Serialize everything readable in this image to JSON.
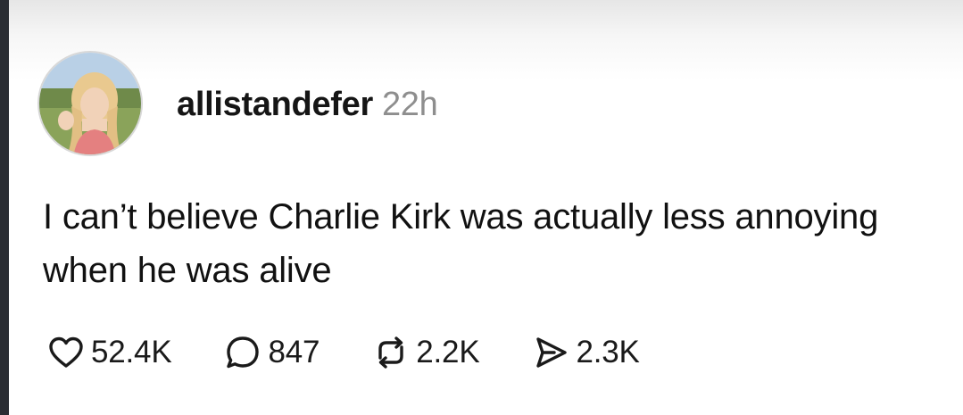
{
  "post": {
    "username": "allistandefer",
    "time_ago": "22h",
    "text": "I can’t believe Charlie Kirk was actually less annoying when he was alive"
  },
  "actions": {
    "likes": {
      "icon": "heart-icon",
      "count": "52.4K"
    },
    "replies": {
      "icon": "comment-icon",
      "count": "847"
    },
    "reposts": {
      "icon": "repost-icon",
      "count": "2.2K"
    },
    "shares": {
      "icon": "send-icon",
      "count": "2.3K"
    }
  }
}
